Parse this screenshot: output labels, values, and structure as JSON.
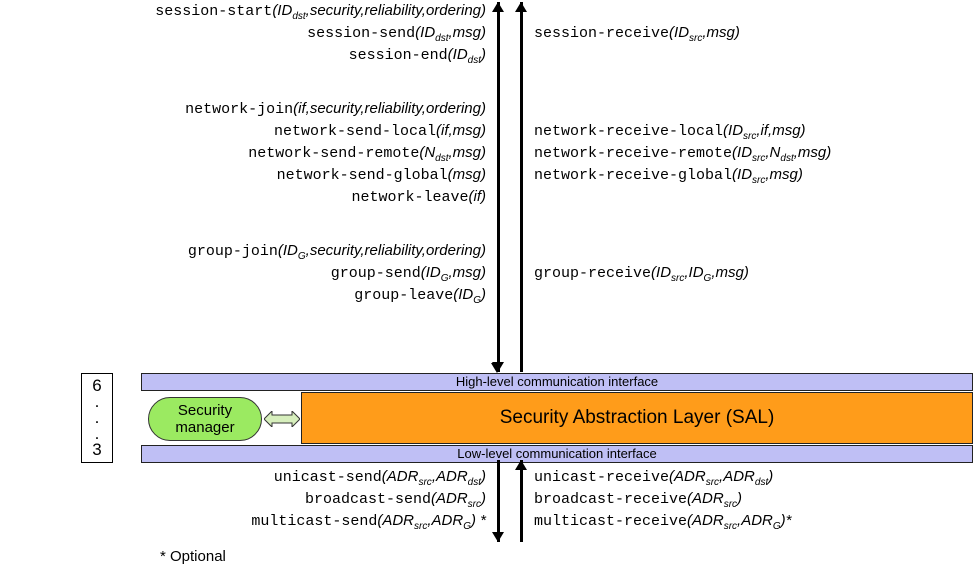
{
  "session": {
    "start": {
      "fn": "session-start",
      "args": "(ID",
      "sub1": "dst",
      "args2": ",security,reliability,ordering)"
    },
    "send": {
      "fn": "session-send",
      "args": "(ID",
      "sub1": "dst",
      "args2": ",msg)"
    },
    "end": {
      "fn": "session-end",
      "args": "(ID",
      "sub1": "dst",
      "args2": ")"
    },
    "receive": {
      "fn": "session-receive",
      "args": "(ID",
      "sub1": "src",
      "args2": ",msg)"
    }
  },
  "network": {
    "join": {
      "fn": "network-join",
      "args": "(if,security,reliability,ordering)"
    },
    "send_local": {
      "fn": "network-send-local",
      "args": "(if,msg)"
    },
    "send_remote": {
      "fn": "network-send-remote",
      "args": "(N",
      "sub1": "dst",
      "args2": ",msg)"
    },
    "send_global": {
      "fn": "network-send-global",
      "args": "(msg)"
    },
    "leave": {
      "fn": "network-leave",
      "args": "(if)"
    },
    "recv_local": {
      "fn": "network-receive-local",
      "args": "(ID",
      "sub1": "src",
      "args2": ",if,msg)"
    },
    "recv_remote": {
      "fn": "network-receive-remote",
      "args": "(ID",
      "sub1": "src",
      "args2": ",N",
      "sub2": "dst",
      "args3": ",msg)"
    },
    "recv_global": {
      "fn": "network-receive-global",
      "args": "(ID",
      "sub1": "src",
      "args2": ",msg)"
    }
  },
  "group": {
    "join": {
      "fn": "group-join",
      "args": "(ID",
      "sub1": "G",
      "args2": ",security,reliability,ordering)"
    },
    "send": {
      "fn": "group-send",
      "args": "(ID",
      "sub1": "G",
      "args2": ",msg)"
    },
    "leave": {
      "fn": "group-leave",
      "args": "(ID",
      "sub1": "G",
      "args2": ")"
    },
    "receive": {
      "fn": "group-receive",
      "args": "(ID",
      "sub1": "src",
      "args2": ",ID",
      "sub2": "G",
      "args3": ",msg)"
    }
  },
  "low": {
    "uni_send": {
      "fn": "unicast-send",
      "args": "(ADR",
      "sub1": "src",
      "args2": ",ADR",
      "sub2": "dst",
      "args3": ")"
    },
    "bc_send": {
      "fn": "broadcast-send",
      "args": "(ADR",
      "sub1": "src",
      "args2": ")"
    },
    "mc_send": {
      "fn": "multicast-send",
      "args": "(ADR",
      "sub1": "src",
      "args2": ",ADR",
      "sub2": "G",
      "args3": ")",
      "star": " *"
    },
    "uni_recv": {
      "fn": "unicast-receive",
      "args": "(ADR",
      "sub1": "src",
      "args2": ",ADR",
      "sub2": "dst",
      "args3": ")"
    },
    "bc_recv": {
      "fn": "broadcast-receive",
      "args": "(ADR",
      "sub1": "src",
      "args2": ")"
    },
    "mc_recv": {
      "fn": "multicast-receive",
      "args": "(ADR",
      "sub1": "src",
      "args2": ",ADR",
      "sub2": "G",
      "args3": ")",
      "star": "*"
    }
  },
  "labels": {
    "hlci": "High-level communication interface",
    "llci": "Low-level communication interface",
    "sal": "Security Abstraction Layer (SAL)",
    "sec_mgr1": "Security",
    "sec_mgr2": "manager",
    "layer_top": "6",
    "layer_bot": "3",
    "optional": "* Optional"
  }
}
